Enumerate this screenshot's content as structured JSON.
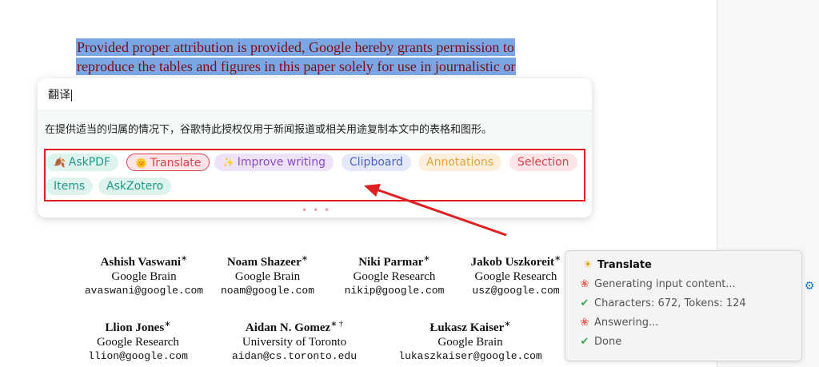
{
  "document": {
    "selected_lines": [
      "Provided proper attribution is provided, Google hereby grants permission to",
      "reproduce the tables and figures in this paper solely for use in journalistic or"
    ],
    "authors": [
      {
        "name": "Ashish Vaswani",
        "mark": "∗",
        "aff": "Google Brain",
        "email": "avaswani@google.com"
      },
      {
        "name": "Noam Shazeer",
        "mark": "∗",
        "aff": "Google Brain",
        "email": "noam@google.com"
      },
      {
        "name": "Niki Parmar",
        "mark": "∗",
        "aff": "Google Research",
        "email": "nikip@google.com"
      },
      {
        "name": "Jakob Uszkoreit",
        "mark": "∗",
        "aff": "Google Research",
        "email": "usz@google.com"
      },
      {
        "name": "Llion Jones",
        "mark": "∗",
        "aff": "Google Research",
        "email": "llion@google.com"
      },
      {
        "name": "Aidan N. Gomez",
        "mark": "∗ †",
        "aff": "University of Toronto",
        "email": "aidan@cs.toronto.edu"
      },
      {
        "name": "Łukasz Kaiser",
        "mark": "∗",
        "aff": "Google Brain",
        "email": "lukaszkaiser@google.com"
      }
    ]
  },
  "popup": {
    "title": "翻译",
    "translation": "在提供适当的归属的情况下，谷歌特此授权仅用于新闻报道或相关用途复制本文中的表格和图形。",
    "dots": "•••",
    "tags": [
      {
        "label": "AskPDF",
        "icon": "leaf-icon",
        "glyph": "🍂",
        "color": "#1d9a84",
        "bg": "#dff3ee"
      },
      {
        "label": "Translate",
        "icon": "sun-icon",
        "glyph": "🌞",
        "color": "#d9414f",
        "bg": "#fde4e6"
      },
      {
        "label": "Improve writing",
        "icon": "sparkle-icon",
        "glyph": "✨",
        "color": "#8a4cc8",
        "bg": "#eee2f8"
      },
      {
        "label": "Clipboard",
        "icon": "",
        "glyph": "",
        "color": "#4a64c8",
        "bg": "#e4e8f8"
      },
      {
        "label": "Annotations",
        "icon": "",
        "glyph": "",
        "color": "#e6a23c",
        "bg": "#fcf0dc"
      },
      {
        "label": "Selection",
        "icon": "",
        "glyph": "",
        "color": "#d9414f",
        "bg": "#fde4e6"
      },
      {
        "label": "Items",
        "icon": "",
        "glyph": "",
        "color": "#1d9a84",
        "bg": "#dff3ee"
      },
      {
        "label": "AskZotero",
        "icon": "",
        "glyph": "",
        "color": "#1d9a84",
        "bg": "#dff3ee"
      }
    ]
  },
  "status": {
    "title": "Translate",
    "steps": [
      {
        "text": "Generating input content...",
        "icon": "ai-icon",
        "glyph": "❀"
      },
      {
        "text": "Characters: 672, Tokens: 124",
        "icon": "check-icon",
        "glyph": "✔"
      },
      {
        "text": "Answering...",
        "icon": "ai-icon",
        "glyph": "❀"
      },
      {
        "text": "Done",
        "icon": "check-icon",
        "glyph": "✔"
      }
    ]
  },
  "colors": {
    "selection": "#7aa6e6",
    "highlight_box": "#e02020",
    "arrow": "#e02020"
  }
}
